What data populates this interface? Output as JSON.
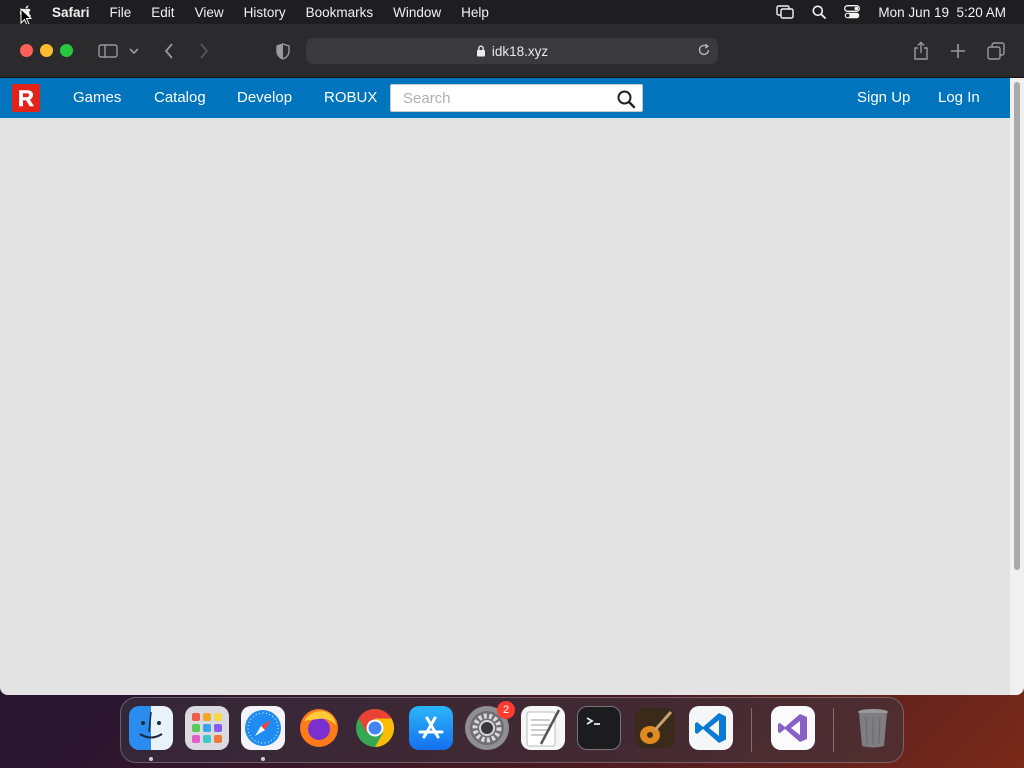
{
  "menubar": {
    "app_name": "Safari",
    "items": [
      "File",
      "Edit",
      "View",
      "History",
      "Bookmarks",
      "Window",
      "Help"
    ],
    "clock": "Mon Jun 19  5:20 AM",
    "status_icons": [
      "screen-mirroring-icon",
      "spotlight-search-icon",
      "control-center-icon"
    ]
  },
  "browser": {
    "url": "idk18.xyz",
    "toolbar_icons": [
      "sidebar-icon",
      "chevron-down-icon",
      "back-icon",
      "forward-icon",
      "privacy-shield-icon",
      "share-icon",
      "new-tab-icon",
      "tab-overview-icon"
    ]
  },
  "site": {
    "logo_letter": "R",
    "nav": {
      "games": "Games",
      "catalog": "Catalog",
      "develop": "Develop",
      "robux": "ROBUX",
      "sign_up": "Sign Up",
      "log_in": "Log In"
    },
    "search": {
      "placeholder": "Search",
      "value": ""
    }
  },
  "dock": {
    "apps": [
      "Finder",
      "Launchpad",
      "Safari",
      "Firefox",
      "Google Chrome",
      "App Store",
      "System Preferences",
      "TextEdit",
      "Terminal",
      "GarageBand",
      "Visual Studio Code",
      "Visual Studio",
      "Trash"
    ],
    "system_preferences_badge": "2"
  },
  "colors": {
    "site_nav": "#0074bd",
    "page_bg": "#e3e3e3",
    "menubar_bg": "#1e1e20",
    "toolbar_bg": "#2b2b2d"
  }
}
